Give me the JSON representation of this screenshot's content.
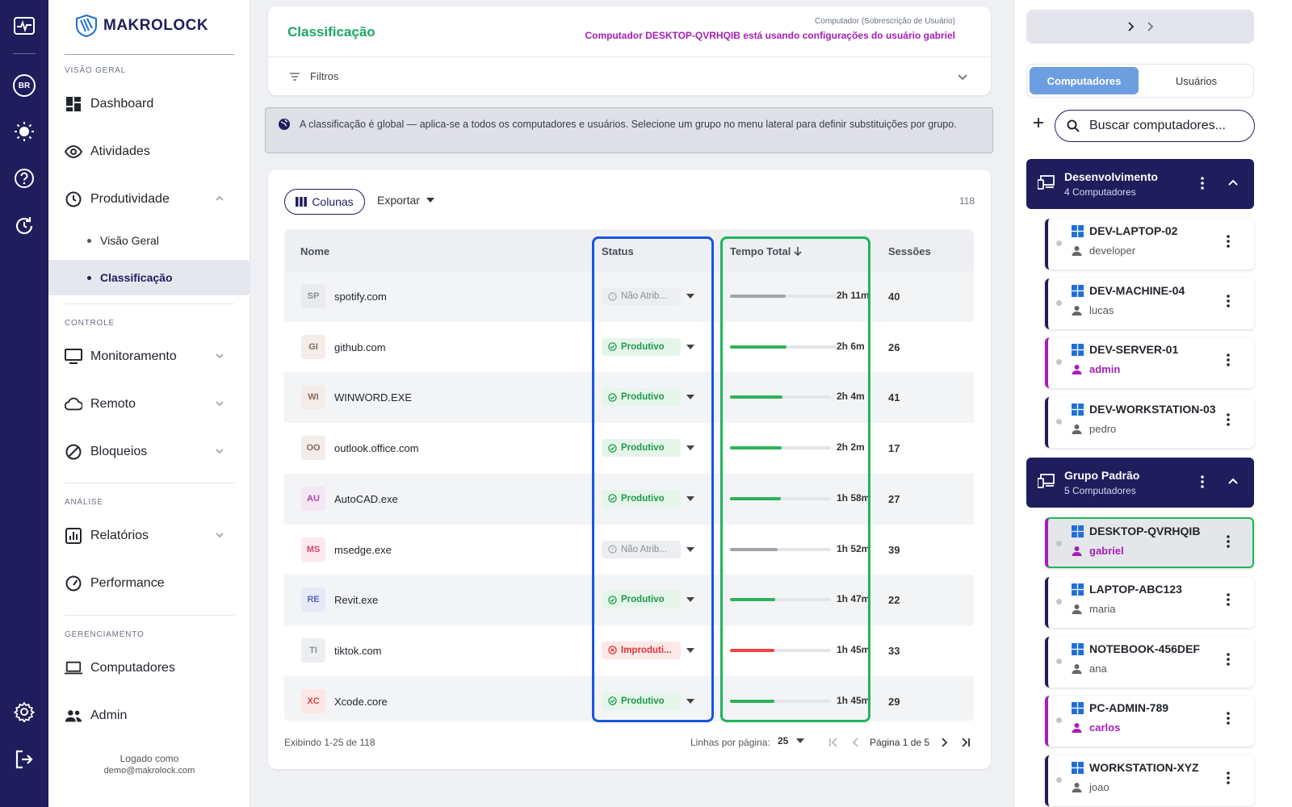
{
  "rail": {
    "locale_badge": "BR"
  },
  "sidebar": {
    "brand": "MAKROLOCK",
    "sections": {
      "overview": "VISÃO GERAL",
      "control": "CONTROLE",
      "analysis": "ANÁLISE",
      "management": "GERENCIAMENTO"
    },
    "items": {
      "dashboard": "Dashboard",
      "activities": "Atividades",
      "productivity": "Produtividade",
      "productivity_overview": "Visão Geral",
      "classification": "Classificação",
      "monitoring": "Monitoramento",
      "remote": "Remoto",
      "blocks": "Bloqueios",
      "reports": "Relatórios",
      "performance": "Performance",
      "computers": "Computadores",
      "admin": "Admin"
    },
    "logged_label": "Logado como",
    "logged_user": "demo@makrolock.com"
  },
  "header": {
    "title": "Classificação",
    "override_label": "Computador (Sobrescrição de Usuário)",
    "override_text": "Computador DESKTOP-QVRHQIB está usando configurações do usuário gabriel",
    "filters_label": "Filtros"
  },
  "info_text": "A classificação é global — aplica-se a todos os computadores e usuários. Selecione um grupo no menu lateral para definir substituições por grupo.",
  "toolbar": {
    "columns_label": "Colunas",
    "export_label": "Exportar",
    "total_count": "118"
  },
  "table": {
    "headers": {
      "name": "Nome",
      "status": "Status",
      "total_time": "Tempo Total",
      "sessions": "Sessões"
    },
    "rows": [
      {
        "abbr": "SP",
        "name": "spotify.com",
        "status": "Não Atrib...",
        "kind": "na",
        "time": "2h 11m",
        "sessions": "40",
        "bar": 0.52,
        "av_bg": "#e9ebee",
        "av_fg": "#8a8f96"
      },
      {
        "abbr": "GI",
        "name": "github.com",
        "status": "Produtivo",
        "kind": "prod",
        "time": "2h 6m",
        "sessions": "26",
        "bar": 0.53,
        "av_bg": "#f3ece8",
        "av_fg": "#8a6a5a"
      },
      {
        "abbr": "WI",
        "name": "WINWORD.EXE",
        "status": "Produtivo",
        "kind": "prod",
        "time": "2h 4m",
        "sessions": "41",
        "bar": 0.52,
        "av_bg": "#f3ece8",
        "av_fg": "#8a6a5a"
      },
      {
        "abbr": "OO",
        "name": "outlook.office.com",
        "status": "Produtivo",
        "kind": "prod",
        "time": "2h 2m",
        "sessions": "17",
        "bar": 0.51,
        "av_bg": "#f3ece8",
        "av_fg": "#8a6a5a"
      },
      {
        "abbr": "AU",
        "name": "AutoCAD.exe",
        "status": "Produtivo",
        "kind": "prod",
        "time": "1h 58m",
        "sessions": "27",
        "bar": 0.5,
        "av_bg": "#f4e6f4",
        "av_fg": "#a64aa6"
      },
      {
        "abbr": "MS",
        "name": "msedge.exe",
        "status": "Não Atrib...",
        "kind": "na",
        "time": "1h 52m",
        "sessions": "39",
        "bar": 0.47,
        "av_bg": "#fce8ee",
        "av_fg": "#d6456e"
      },
      {
        "abbr": "RE",
        "name": "Revit.exe",
        "status": "Produtivo",
        "kind": "prod",
        "time": "1h 47m",
        "sessions": "22",
        "bar": 0.45,
        "av_bg": "#e6e9f7",
        "av_fg": "#5a66c0"
      },
      {
        "abbr": "TI",
        "name": "tiktok.com",
        "status": "Improduti...",
        "kind": "imp",
        "time": "1h 45m",
        "sessions": "33",
        "bar": 0.44,
        "av_bg": "#eceef1",
        "av_fg": "#8a8f96"
      },
      {
        "abbr": "XC",
        "name": "Xcode.core",
        "status": "Produtivo",
        "kind": "prod",
        "time": "1h 45m",
        "sessions": "29",
        "bar": 0.44,
        "av_bg": "#fce6e6",
        "av_fg": "#d64545"
      }
    ],
    "showing": "Exibindo 1-25 de 118",
    "rows_per_page_label": "Linhas por página:",
    "rows_per_page": "25",
    "page_label": "Página 1 de 5"
  },
  "colors": {
    "produtivo": "#2eb35a",
    "nao_atribuido": "#a0a3a8",
    "improdutivo": "#ef4444",
    "primary": "#1f1d5c",
    "accent_green": "#1aa865",
    "override": "#a51fb5"
  },
  "right_panel": {
    "tabs": [
      "Computadores",
      "Usuários"
    ],
    "search_placeholder": "Buscar computadores...",
    "groups": [
      {
        "name": "Desenvolvimento",
        "count": "4 Computadores",
        "computers": [
          {
            "name": "DEV-LAPTOP-02",
            "user": "developer",
            "admin": false
          },
          {
            "name": "DEV-MACHINE-04",
            "user": "lucas",
            "admin": false
          },
          {
            "name": "DEV-SERVER-01",
            "user": "admin",
            "admin": true
          },
          {
            "name": "DEV-WORKSTATION-03",
            "user": "pedro",
            "admin": false
          }
        ]
      },
      {
        "name": "Grupo Padrão",
        "count": "5 Computadores",
        "computers": [
          {
            "name": "DESKTOP-QVRHQIB",
            "user": "gabriel",
            "admin": true,
            "selected": true
          },
          {
            "name": "LAPTOP-ABC123",
            "user": "maria",
            "admin": false
          },
          {
            "name": "NOTEBOOK-456DEF",
            "user": "ana",
            "admin": false
          },
          {
            "name": "PC-ADMIN-789",
            "user": "carlos",
            "admin": true
          },
          {
            "name": "WORKSTATION-XYZ",
            "user": "joao",
            "admin": false
          }
        ]
      }
    ]
  }
}
